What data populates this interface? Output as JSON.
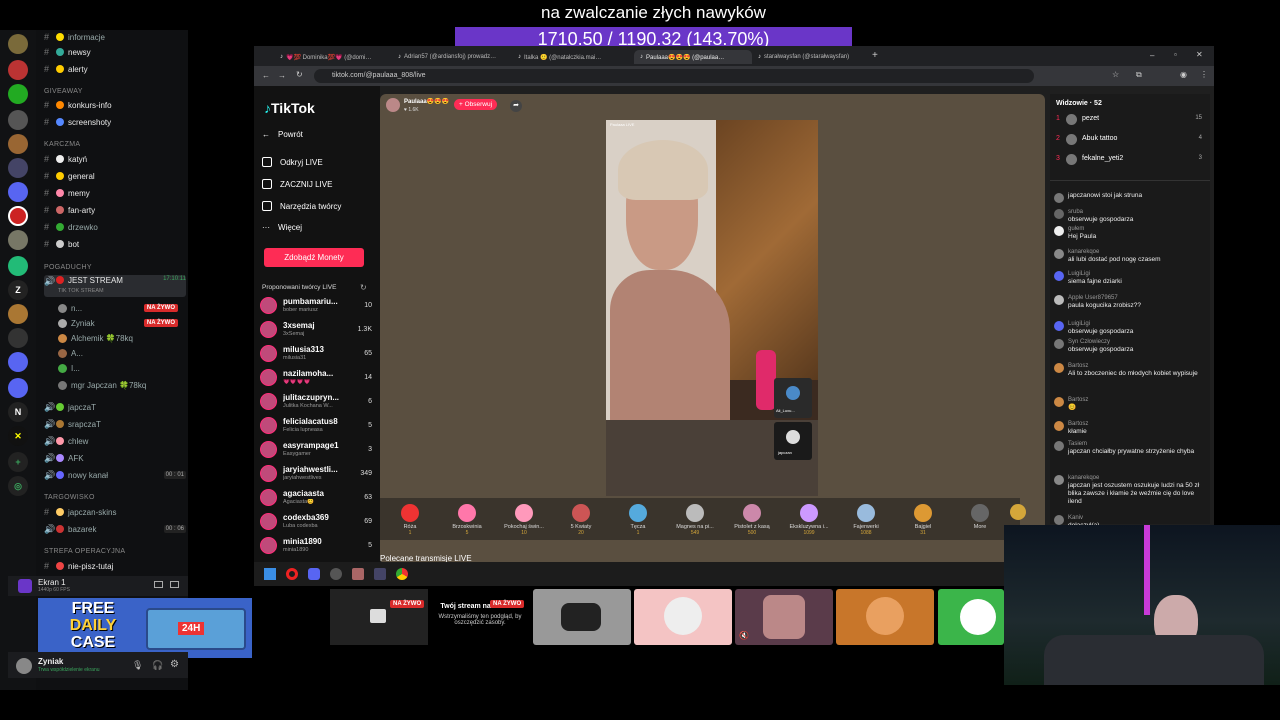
{
  "overlay": {
    "title": "na zwalczanie złych nawyków",
    "progress": "1710.50 / 1190.32 (143.70%)"
  },
  "discord": {
    "categories": [
      {
        "label": "GIVEAWAY"
      },
      {
        "label": "KARCZMA"
      },
      {
        "label": "POGADUCHY"
      },
      {
        "label": "TARGOWISKO"
      },
      {
        "label": "STREFA OPERACYJNA"
      }
    ],
    "channels": {
      "informacje": "informacje",
      "newsy": "newsy",
      "alerty": "alerty",
      "konkurs": "konkurs-info",
      "screenshoty": "screenshoty",
      "katyn": "katyń",
      "general": "general",
      "memy": "memy",
      "fanarty": "fan-arty",
      "drzewko": "drzewko",
      "bot": "bot",
      "jestStream": "JEST STREAM",
      "jestStreamTime": "17:10:11",
      "jestStreamSub": "TIK TOK STREAM",
      "japczaT": "japczaT",
      "srapczaT": "srapczaT",
      "chlew": "chlew",
      "afk": "AFK",
      "nowy": "nowy kanał",
      "japczanskins": "japczan-skins",
      "bazarek": "bazarek",
      "niepisz": "nie-pisz-tutaj"
    },
    "voice_users": [
      {
        "name": "n...",
        "live": "NA ŻYWO"
      },
      {
        "name": "Zyniak",
        "live": "NA ŻYWO"
      },
      {
        "name": "Alchemik 🍀78kq",
        "live": ""
      },
      {
        "name": "A...",
        "live": ""
      },
      {
        "name": "I...",
        "live": ""
      },
      {
        "name": "mgr Japczan 🍀78kq",
        "live": ""
      }
    ],
    "counts": {
      "nowy": "00 : 01",
      "bazarek": "00 : 06"
    },
    "screen": {
      "title": "Ekran 1",
      "sub": "1440p 60 FPS"
    },
    "user": {
      "name": "Zyniak",
      "status": "Trwa współdzielenie ekranu"
    },
    "promo": {
      "line1": "FREE",
      "line2": "DAILY",
      "line3": "CASE",
      "badge": "24H"
    }
  },
  "browser": {
    "tabs": [
      "💗💯 Dominika💯💗 (@domi…",
      "Adrian57 (@ardiansfoj) prowadz…",
      "Italka 🙂 (@natalczkia.mai…",
      "Paulaaa😍😍😍 (@paulaa…",
      "starałwaysfan (@starałwaysfan)"
    ],
    "url": "tiktok.com/@paulaaa_808/live"
  },
  "tiktok": {
    "logo": "TikTok",
    "nav": {
      "back": "Powrót",
      "discover": "Odkryj LIVE",
      "start": "ZACZNIJ LIVE",
      "tools": "Narzędzia twórcy",
      "more": "Więcej"
    },
    "coins_button": "Zdobądź Monety",
    "recommended_title": "Proponowani twórcy LIVE",
    "recommended": [
      {
        "name": "pumbamariu...",
        "sub": "bober mariusz",
        "num": "10"
      },
      {
        "name": "3xsemaj",
        "sub": "3xSemaj",
        "num": "1.3K"
      },
      {
        "name": "milusia313",
        "sub": "milusia31",
        "num": "65"
      },
      {
        "name": "nazilamoha...",
        "sub": "💗💗💗💗",
        "num": "14"
      },
      {
        "name": "julitaczupryn...",
        "sub": "Julitka Kochana W...",
        "num": "6"
      },
      {
        "name": "felicialacatus8",
        "sub": "Felicia lupneasa",
        "num": "5"
      },
      {
        "name": "easyrampage1",
        "sub": "Easygamer",
        "num": "3"
      },
      {
        "name": "jaryiahwestli...",
        "sub": "jaryiahwestlives",
        "num": "349"
      },
      {
        "name": "agaciaasta",
        "sub": "Agaciasta😊",
        "num": "63"
      },
      {
        "name": "codexba369",
        "sub": "Luba codexba",
        "num": "69"
      },
      {
        "name": "minia1890",
        "sub": "minia1890",
        "num": "5"
      }
    ],
    "host": {
      "name": "Paulaaa😍😍😍",
      "likes": "1.6K",
      "follow": "+ Obserwuj"
    },
    "video_label": "Paulaaa LIVE",
    "guests": [
      "Ali_Luxu...",
      "japczan"
    ],
    "gifts": [
      {
        "name": "Róża",
        "price": "1"
      },
      {
        "name": "Brzoskwinia",
        "price": "5"
      },
      {
        "name": "Pokochaj świn...",
        "price": "10"
      },
      {
        "name": "5 Kwiaty",
        "price": "20"
      },
      {
        "name": "Tęcza",
        "price": "1"
      },
      {
        "name": "Magnes na pi...",
        "price": "549"
      },
      {
        "name": "Pistolet z kasą",
        "price": "500"
      },
      {
        "name": "Ekskluzywna i...",
        "price": "1099"
      },
      {
        "name": "Fajerwerki",
        "price": "1088"
      },
      {
        "name": "Bajgiel",
        "price": "31"
      },
      {
        "name": "More",
        "price": ""
      }
    ],
    "more_live": "Polecane transmisje LIVE",
    "viewers_title": "Widzowie · 52",
    "top_viewers": [
      {
        "rank": "1",
        "name": "pezet",
        "score": "15"
      },
      {
        "rank": "2",
        "name": "Abuk tattoo",
        "score": "4"
      },
      {
        "rank": "3",
        "name": "fekalne_yeti2",
        "score": "3"
      }
    ],
    "chat": [
      {
        "user": "",
        "text": "japczanowi stoi jak struna"
      },
      {
        "user": "sruba",
        "text": "obserwuje gospodarza"
      },
      {
        "user": "gułem",
        "text": "Hej Paula"
      },
      {
        "user": "kanarekqoe",
        "text": "ali lubi dostać pod nogę czasem"
      },
      {
        "user": "LuigiLigi",
        "text": "siema fajne dziarki"
      },
      {
        "user": "Apple User879657",
        "text": "paula kogucika zrobisz??"
      },
      {
        "user": "LuigiLigi",
        "text": "obserwuje gospodarza"
      },
      {
        "user": "Syn Człowieczy",
        "text": "obserwuje gospodarza"
      },
      {
        "user": "Bartosz",
        "text": "Ali to zboczeniec do młodych kobiet wypisuje"
      },
      {
        "user": "Bartosz",
        "text": "😊"
      },
      {
        "user": "Bartosz",
        "text": "kłamie"
      },
      {
        "user": "Tasiem",
        "text": "japczan chciałby prywatne strzyżenie chyba"
      },
      {
        "user": "kanarekqoe",
        "text": "japczan jest oszustem oszukuje ludzi na 50 zł blika zawsze i kłamie że weźmie cię do love ilend"
      },
      {
        "user": "Kaniv",
        "text": "dołączył(a)"
      }
    ]
  },
  "taskbar": {
    "apps": [
      "windows",
      "opera",
      "discord",
      "steam-like",
      "app",
      "steam",
      "chrome"
    ]
  },
  "bottom": {
    "live": "NA ŻYWO",
    "title": "Twój stream nadal trwa!",
    "text": "Wstrzymaliśmy ten podgląd, by oszczędzić zasoby.",
    "live2": "NA ŻYWO"
  },
  "colors": {
    "tiktok_pink": "#fe2c55",
    "overlay_purple": "#6a36c8",
    "discord_live": "#d92b2b"
  }
}
